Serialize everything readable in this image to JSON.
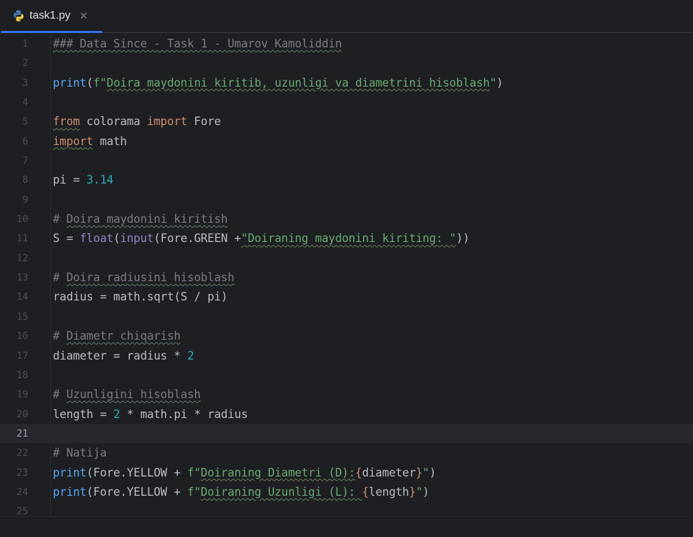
{
  "tab": {
    "icon": "python-file-icon",
    "label": "task1.py",
    "close_glyph": "✕"
  },
  "current_line": 21,
  "lines": [
    {
      "n": "1",
      "tokens": [
        {
          "t": "### Data Since - Task 1 - Umarov Kamoliddin",
          "c": "cm typo-c"
        }
      ]
    },
    {
      "n": "2",
      "tokens": []
    },
    {
      "n": "3",
      "tokens": [
        {
          "t": "print",
          "c": "fn"
        },
        {
          "t": "(",
          "c": ""
        },
        {
          "t": "f\"",
          "c": "str"
        },
        {
          "t": "Doira maydonini kiritib, uzunligi va diametrini hisoblash",
          "c": "str typo"
        },
        {
          "t": "\"",
          "c": "str"
        },
        {
          "t": ")",
          "c": ""
        }
      ]
    },
    {
      "n": "4",
      "tokens": []
    },
    {
      "n": "5",
      "tokens": [
        {
          "t": "from",
          "c": "kw typo"
        },
        {
          "t": " colorama ",
          "c": ""
        },
        {
          "t": "import",
          "c": "kw"
        },
        {
          "t": " Fore",
          "c": ""
        }
      ]
    },
    {
      "n": "6",
      "tokens": [
        {
          "t": "import",
          "c": "kw typo"
        },
        {
          "t": " math",
          "c": ""
        }
      ]
    },
    {
      "n": "7",
      "tokens": []
    },
    {
      "n": "8",
      "tokens": [
        {
          "t": "pi = ",
          "c": ""
        },
        {
          "t": "3.14",
          "c": "num"
        }
      ]
    },
    {
      "n": "9",
      "tokens": []
    },
    {
      "n": "10",
      "tokens": [
        {
          "t": "# ",
          "c": "cm"
        },
        {
          "t": "Doira maydonini kiritish",
          "c": "cm typo-c"
        }
      ]
    },
    {
      "n": "11",
      "tokens": [
        {
          "t": "S = ",
          "c": ""
        },
        {
          "t": "float",
          "c": "bi"
        },
        {
          "t": "(",
          "c": ""
        },
        {
          "t": "input",
          "c": "bi"
        },
        {
          "t": "(Fore.GREEN +",
          "c": ""
        },
        {
          "t": "\"Doiraning maydonini kiriting: \"",
          "c": "str typo"
        },
        {
          "t": "))",
          "c": ""
        }
      ]
    },
    {
      "n": "12",
      "tokens": []
    },
    {
      "n": "13",
      "tokens": [
        {
          "t": "# ",
          "c": "cm"
        },
        {
          "t": "Doira radiusini hisoblash",
          "c": "cm typo-c"
        }
      ]
    },
    {
      "n": "14",
      "tokens": [
        {
          "t": "radius = math.sqrt(S / pi)",
          "c": ""
        }
      ]
    },
    {
      "n": "15",
      "tokens": []
    },
    {
      "n": "16",
      "tokens": [
        {
          "t": "# ",
          "c": "cm"
        },
        {
          "t": "Diametr chiqarish",
          "c": "cm typo-c"
        }
      ]
    },
    {
      "n": "17",
      "tokens": [
        {
          "t": "diameter = radius * ",
          "c": ""
        },
        {
          "t": "2",
          "c": "num"
        }
      ]
    },
    {
      "n": "18",
      "tokens": []
    },
    {
      "n": "19",
      "tokens": [
        {
          "t": "# ",
          "c": "cm"
        },
        {
          "t": "Uzunligini hisoblash",
          "c": "cm typo-c"
        }
      ]
    },
    {
      "n": "20",
      "tokens": [
        {
          "t": "length = ",
          "c": ""
        },
        {
          "t": "2",
          "c": "num"
        },
        {
          "t": " * math.pi * radius",
          "c": ""
        }
      ]
    },
    {
      "n": "21",
      "tokens": []
    },
    {
      "n": "22",
      "tokens": [
        {
          "t": "# Natija",
          "c": "cm"
        }
      ]
    },
    {
      "n": "23",
      "tokens": [
        {
          "t": "print",
          "c": "fn"
        },
        {
          "t": "(Fore.YELLOW + ",
          "c": ""
        },
        {
          "t": "f\"",
          "c": "str"
        },
        {
          "t": "Doiraning Diametri (D):",
          "c": "str typo"
        },
        {
          "t": "{",
          "c": "brace"
        },
        {
          "t": "diameter",
          "c": ""
        },
        {
          "t": "}",
          "c": "brace"
        },
        {
          "t": "\"",
          "c": "str"
        },
        {
          "t": ")",
          "c": ""
        }
      ]
    },
    {
      "n": "24",
      "tokens": [
        {
          "t": "print",
          "c": "fn"
        },
        {
          "t": "(Fore.YELLOW + ",
          "c": ""
        },
        {
          "t": "f\"",
          "c": "str"
        },
        {
          "t": "Doiraning Uzunligi (L): ",
          "c": "str typo"
        },
        {
          "t": "{",
          "c": "brace"
        },
        {
          "t": "length",
          "c": ""
        },
        {
          "t": "}",
          "c": "brace"
        },
        {
          "t": "\"",
          "c": "str"
        },
        {
          "t": ")",
          "c": ""
        }
      ]
    },
    {
      "n": "25",
      "tokens": []
    }
  ],
  "colors": {
    "background": "#1e1f22",
    "tab_underline": "#3574f0",
    "keyword": "#cf8e6d",
    "function": "#56a8f5",
    "builtin": "#8888c6",
    "string": "#6aab73",
    "number": "#2aacb8",
    "comment": "#7a7e85"
  }
}
